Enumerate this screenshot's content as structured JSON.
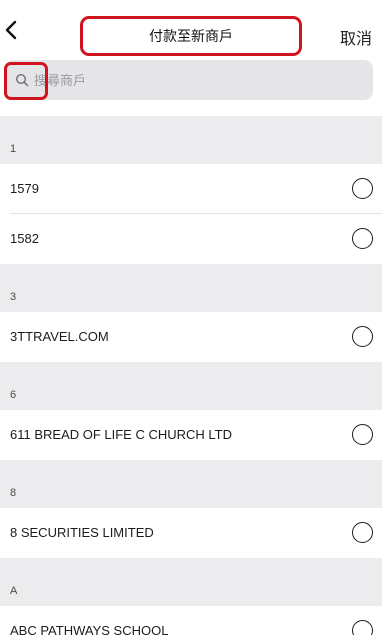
{
  "navbar": {
    "title": "付款至新商戶",
    "cancel_label": "取消",
    "back_icon": "chevron-left-icon"
  },
  "search": {
    "placeholder": "搜尋商戶",
    "value": "",
    "icon": "search-icon"
  },
  "colors": {
    "highlight": "#d0141e",
    "section_bg": "#ececee",
    "search_bg": "#e5e5e7"
  },
  "sections": [
    {
      "header": "1",
      "items": [
        {
          "label": "1579"
        },
        {
          "label": "1582"
        }
      ]
    },
    {
      "header": "3",
      "items": [
        {
          "label": "3TTRAVEL.COM"
        }
      ]
    },
    {
      "header": "6",
      "items": [
        {
          "label": "611 BREAD OF LIFE C CHURCH LTD"
        }
      ]
    },
    {
      "header": "8",
      "items": [
        {
          "label": "8 SECURITIES LIMITED"
        }
      ]
    },
    {
      "header": "A",
      "items": [
        {
          "label": "ABC PATHWAYS SCHOOL"
        }
      ]
    }
  ]
}
